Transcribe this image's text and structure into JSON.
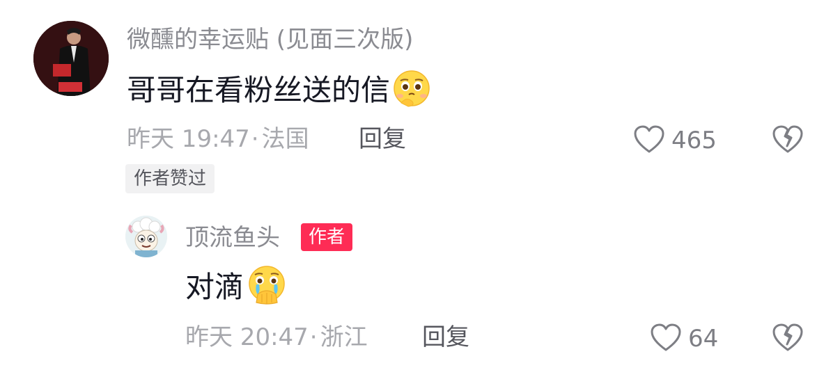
{
  "comment": {
    "username": "微醺的幸运贴 (见面三次版)",
    "text": "哥哥在看粉丝送的信",
    "emoji": "pleading-face-emoji",
    "timestamp": "昨天 19:47",
    "separator": "·",
    "location": "法国",
    "reply_label": "回复",
    "likes": "465",
    "author_liked_label": "作者赞过"
  },
  "reply": {
    "username": "顶流鱼头",
    "author_badge": "作者",
    "text": "对滴",
    "emoji": "crying-face-hands-emoji",
    "timestamp": "昨天 20:47",
    "separator": "·",
    "location": "浙江",
    "reply_label": "回复",
    "likes": "64"
  },
  "colors": {
    "username": "#8a8b91",
    "meta": "#a7a8ad",
    "author_badge_bg": "#fe2c55",
    "author_liked_bg": "#f1f1f2"
  }
}
